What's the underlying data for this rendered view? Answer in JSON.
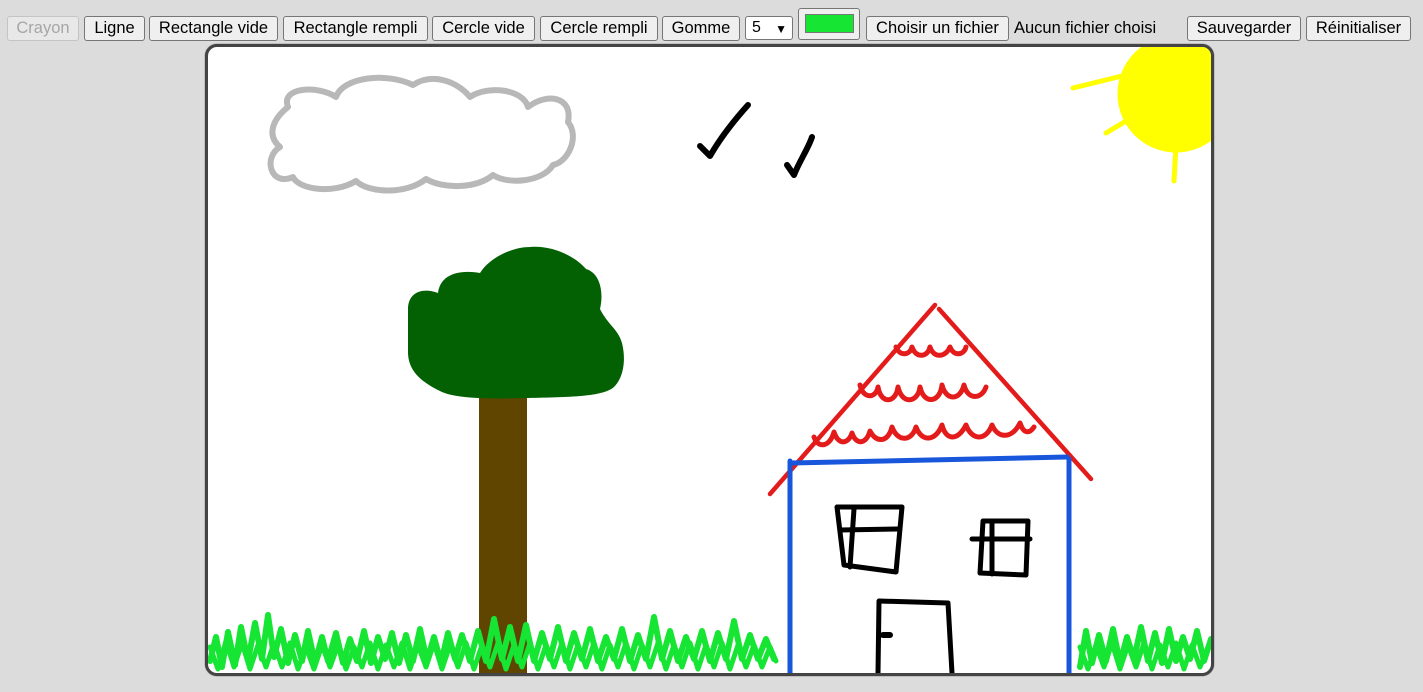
{
  "toolbar": {
    "tools": [
      {
        "label": "Crayon",
        "disabled": true
      },
      {
        "label": "Ligne"
      },
      {
        "label": "Rectangle vide"
      },
      {
        "label": "Rectangle rempli"
      },
      {
        "label": "Cercle vide"
      },
      {
        "label": "Cercle rempli"
      },
      {
        "label": "Gomme"
      }
    ],
    "brush_size": {
      "value": "5"
    },
    "color": {
      "value": "#16e534"
    },
    "file": {
      "button_label": "Choisir un fichier",
      "status": "Aucun fichier choisi"
    },
    "save_label": "Sauvegarder",
    "reset_label": "Réinitialiser"
  },
  "canvas": {
    "background": "#ffffff",
    "colors": {
      "cloud": "#b8b8b8",
      "birds": "#000000",
      "sun": "#ffff00",
      "tree_foliage": "#036003",
      "tree_trunk": "#604500",
      "roof": "#e41b1b",
      "house_walls": "#1857dc",
      "windows_door": "#000000",
      "grass": "#16e534"
    }
  }
}
